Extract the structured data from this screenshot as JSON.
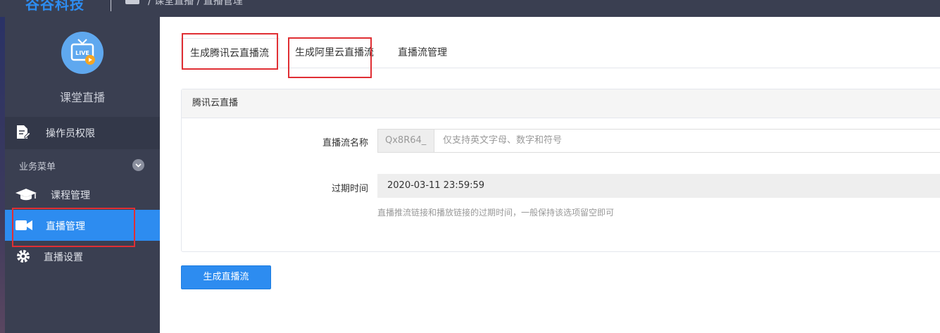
{
  "header": {
    "logo": "谷谷科技",
    "breadcrumb": "/ 课堂直播 / 直播管理"
  },
  "sidebar": {
    "app_title": "课堂直播",
    "avatar_text": "LIVE",
    "items": [
      {
        "label": "操作员权限",
        "icon": "document-edit-icon"
      },
      {
        "label": "课程管理",
        "icon": "graduation-cap-icon"
      },
      {
        "label": "直播管理",
        "icon": "video-camera-icon"
      },
      {
        "label": "直播设置",
        "icon": "gear-icon"
      }
    ],
    "group_label": "业务菜单"
  },
  "tabs": [
    {
      "label": "生成腾讯云直播流"
    },
    {
      "label": "生成阿里云直播流"
    },
    {
      "label": "直播流管理"
    }
  ],
  "panel": {
    "title": "腾讯云直播",
    "stream_name_label": "直播流名称",
    "stream_prefix": "Qx8R64_",
    "stream_placeholder": "仅支持英文字母、数字和符号",
    "expire_label": "过期时间",
    "expire_value": "2020-03-11 23:59:59",
    "expire_help": "直播推流链接和播放链接的过期时间，一般保持该选项留空即可"
  },
  "submit_label": "生成直播流",
  "colors": {
    "accent": "#2d8cf0",
    "sidebar": "#3a3f51",
    "highlight": "#e02f34"
  }
}
